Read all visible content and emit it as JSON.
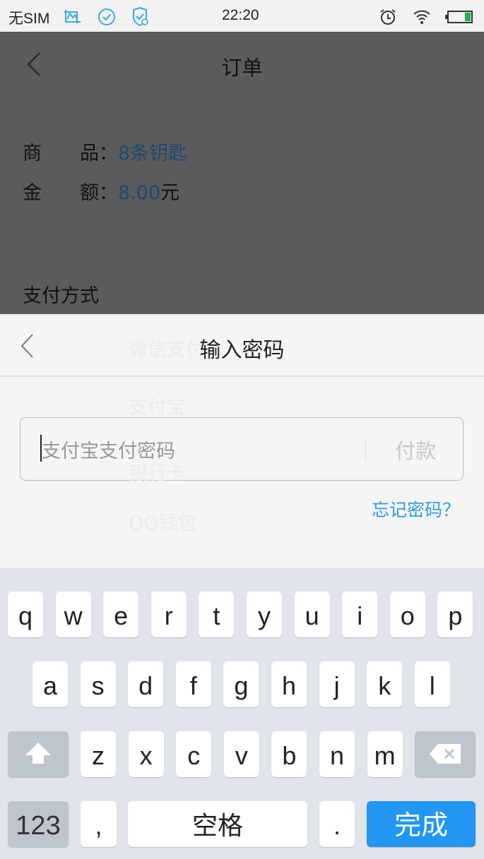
{
  "status_bar": {
    "carrier": "无SIM",
    "time": "22:20",
    "icons": [
      "gallery-icon",
      "check-circle-icon",
      "shield-icon",
      "alarm-icon",
      "wifi-icon",
      "battery-icon"
    ],
    "battery_color": "#22b14c"
  },
  "order_page": {
    "title": "订单",
    "product_label": "商　　品：",
    "product_value": "8条钥匙",
    "amount_label": "金　　额：",
    "amount_value": "8.00",
    "amount_unit": "元",
    "payment_section": "支付方式",
    "payment_methods": [
      "微信支付",
      "支付宝",
      "银行卡",
      "QQ钱包"
    ]
  },
  "password_sheet": {
    "title": "输入密码",
    "placeholder": "支付宝支付密码",
    "pay_button": "付款",
    "forgot_link": "忘记密码？",
    "link_color": "#2a9de6"
  },
  "keyboard": {
    "row1": [
      "q",
      "w",
      "e",
      "r",
      "t",
      "y",
      "u",
      "i",
      "o",
      "p"
    ],
    "row2": [
      "a",
      "s",
      "d",
      "f",
      "g",
      "h",
      "j",
      "k",
      "l"
    ],
    "row3": [
      "z",
      "x",
      "c",
      "v",
      "b",
      "n",
      "m"
    ],
    "numbers_key": "123",
    "comma": ",",
    "space": "空格",
    "period": ".",
    "done": "完成",
    "done_color": "#2196f3"
  }
}
